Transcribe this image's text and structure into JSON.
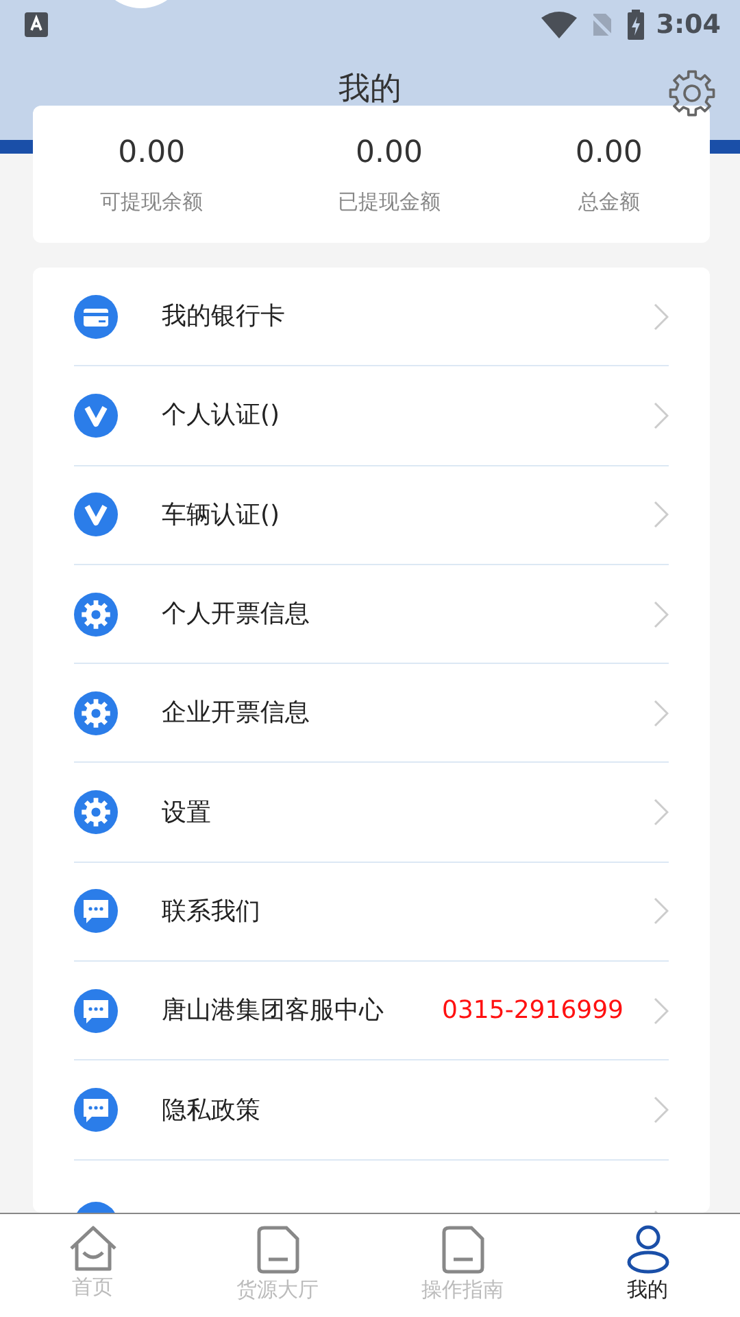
{
  "status_bar": {
    "time": "3:04"
  },
  "header": {
    "title": "我的"
  },
  "summary": [
    {
      "value": "0.00",
      "label": "可提现余额"
    },
    {
      "value": "0.00",
      "label": "已提现金额"
    },
    {
      "value": "0.00",
      "label": "总金额"
    }
  ],
  "menu": [
    {
      "kind": "card",
      "label": "我的银行卡"
    },
    {
      "kind": "verify",
      "label": "个人认证()"
    },
    {
      "kind": "verify",
      "label": "车辆认证()"
    },
    {
      "kind": "gear",
      "label": "个人开票信息"
    },
    {
      "kind": "gear",
      "label": "企业开票信息"
    },
    {
      "kind": "gear",
      "label": "设置"
    },
    {
      "kind": "chat",
      "label": "联系我们"
    },
    {
      "kind": "chat",
      "label": "唐山港集团客服中心",
      "phone": "0315-2916999"
    },
    {
      "kind": "chat",
      "label": "隐私政策"
    },
    {
      "kind": "chat"
    }
  ],
  "bottom_nav": [
    {
      "kind": "home",
      "label": "首页",
      "selected": false
    },
    {
      "kind": "doc",
      "label": "货源大厅",
      "selected": false
    },
    {
      "kind": "doc",
      "label": "操作指南",
      "selected": false
    },
    {
      "kind": "user",
      "label": "我的",
      "selected": true
    }
  ]
}
